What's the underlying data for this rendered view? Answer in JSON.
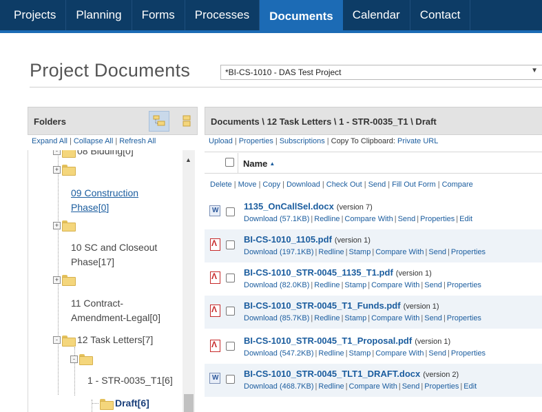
{
  "nav": {
    "tabs": [
      {
        "label": "Projects"
      },
      {
        "label": "Planning"
      },
      {
        "label": "Forms"
      },
      {
        "label": "Processes"
      },
      {
        "label": "Documents",
        "active": true
      },
      {
        "label": "Calendar"
      },
      {
        "label": "Contact"
      }
    ]
  },
  "page": {
    "title": "Project Documents",
    "project_select_value": "*BI-CS-1010 - DAS Test Project"
  },
  "folders": {
    "title": "Folders",
    "links": {
      "expand_all": "Expand All",
      "collapse_all": "Collapse All",
      "refresh_all": "Refresh All"
    },
    "tree": {
      "bidding": "08 Bidding[0]",
      "construction": "09 Construction",
      "construction_2": "Phase[0]",
      "closeout": "10 SC and Closeout",
      "closeout_2": "Phase[17]",
      "contract": "11 Contract-",
      "contract_2": "Amendment-Legal[0]",
      "task_letters": "12 Task Letters[7]",
      "str": "1 - STR-0035_T1[6]",
      "draft": "Draft[6]"
    }
  },
  "documents": {
    "breadcrumb": "Documents \\ 12 Task Letters \\ 1 - STR-0035_T1 \\ Draft",
    "toolbar": {
      "upload": "Upload",
      "properties": "Properties",
      "subscriptions": "Subscriptions",
      "copy_label": "Copy To Clipboard:",
      "private_url": "Private URL"
    },
    "name_header": "Name",
    "actions": {
      "delete": "Delete",
      "move": "Move",
      "copy": "Copy",
      "download": "Download",
      "check_out": "Check Out",
      "send": "Send",
      "fill_out_form": "Fill Out Form",
      "compare": "Compare"
    },
    "rows": [
      {
        "icon": "word-doc-icon",
        "name": "1135_OnCallSel.docx",
        "version": "(version 7)",
        "download": "Download (57.1KB)",
        "l1": "Redline",
        "l2": "Compare With",
        "l3": "Send",
        "l4": "Properties",
        "l5": "Edit"
      },
      {
        "icon": "pdf-icon",
        "name": "BI-CS-1010_1105.pdf",
        "version": "(version 1)",
        "download": "Download (197.1KB)",
        "l1": "Redline",
        "l2": "Stamp",
        "l3": "Compare With",
        "l4": "Send",
        "l5": "Properties"
      },
      {
        "icon": "pdf-icon",
        "name": "BI-CS-1010_STR-0045_1135_T1.pdf",
        "version": "(version 1)",
        "download": "Download (82.0KB)",
        "l1": "Redline",
        "l2": "Stamp",
        "l3": "Compare With",
        "l4": "Send",
        "l5": "Properties"
      },
      {
        "icon": "pdf-icon",
        "name": "BI-CS-1010_STR-0045_T1_Funds.pdf",
        "version": "(version 1)",
        "download": "Download (85.7KB)",
        "l1": "Redline",
        "l2": "Stamp",
        "l3": "Compare With",
        "l4": "Send",
        "l5": "Properties"
      },
      {
        "icon": "pdf-icon",
        "name": "BI-CS-1010_STR-0045_T1_Proposal.pdf",
        "version": "(version 1)",
        "download": "Download (547.2KB)",
        "l1": "Redline",
        "l2": "Stamp",
        "l3": "Compare With",
        "l4": "Send",
        "l5": "Properties"
      },
      {
        "icon": "word-doc-icon",
        "name": "BI-CS-1010_STR-0045_TLT1_DRAFT.docx",
        "version": "(version 2)",
        "download": "Download (468.7KB)",
        "l1": "Redline",
        "l2": "Compare With",
        "l3": "Send",
        "l4": "Properties",
        "l5": "Edit"
      }
    ]
  },
  "colors": {
    "nav_bg": "#0d3c66",
    "nav_active": "#1c6bb5",
    "link": "#1a5c9e",
    "folder": "#f4d67c"
  }
}
